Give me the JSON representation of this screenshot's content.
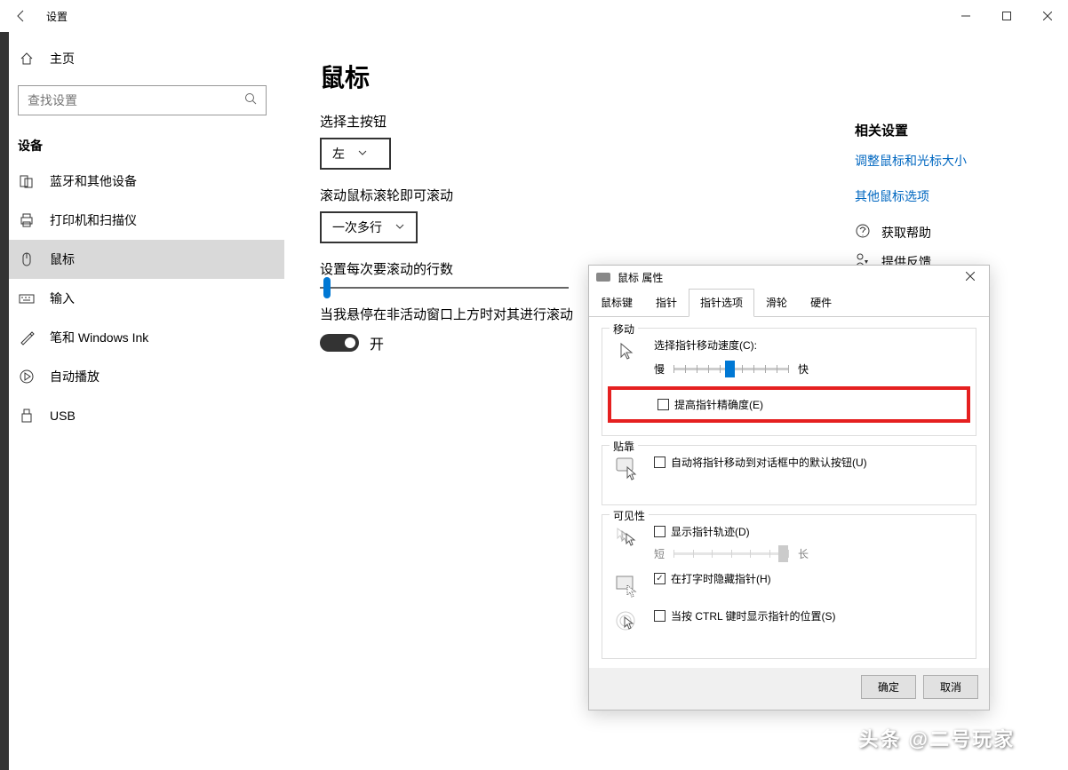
{
  "window": {
    "title": "设置"
  },
  "sidebar": {
    "home": "主页",
    "search_placeholder": "查找设置",
    "section": "设备",
    "items": [
      {
        "label": "蓝牙和其他设备"
      },
      {
        "label": "打印机和扫描仪"
      },
      {
        "label": "鼠标"
      },
      {
        "label": "输入"
      },
      {
        "label": "笔和 Windows Ink"
      },
      {
        "label": "自动播放"
      },
      {
        "label": "USB"
      }
    ]
  },
  "main": {
    "title": "鼠标",
    "primary_button_label": "选择主按钮",
    "primary_button_value": "左",
    "scroll_mode_label": "滚动鼠标滚轮即可滚动",
    "scroll_mode_value": "一次多行",
    "lines_label": "设置每次要滚动的行数",
    "inactive_label": "当我悬停在非活动窗口上方时对其进行滚动",
    "toggle_on": "开"
  },
  "related": {
    "title": "相关设置",
    "link1": "调整鼠标和光标大小",
    "link2": "其他鼠标选项",
    "help1": "获取帮助",
    "help2": "提供反馈"
  },
  "dialog": {
    "title": "鼠标 属性",
    "tabs": [
      "鼠标键",
      "指针",
      "指针选项",
      "滑轮",
      "硬件"
    ],
    "active_tab": 2,
    "movement": {
      "legend": "移动",
      "speed_label": "选择指针移动速度(C):",
      "slow": "慢",
      "fast": "快",
      "enhance": "提高指针精确度(E)"
    },
    "snap": {
      "legend": "贴靠",
      "auto_move": "自动将指针移动到对话框中的默认按钮(U)"
    },
    "visibility": {
      "legend": "可见性",
      "trails": "显示指针轨迹(D)",
      "short": "短",
      "long": "长",
      "hide_typing": "在打字时隐藏指针(H)",
      "ctrl_locate": "当按 CTRL 键时显示指针的位置(S)"
    },
    "ok": "确定",
    "cancel": "取消"
  },
  "watermark": "头条 @二号玩家"
}
